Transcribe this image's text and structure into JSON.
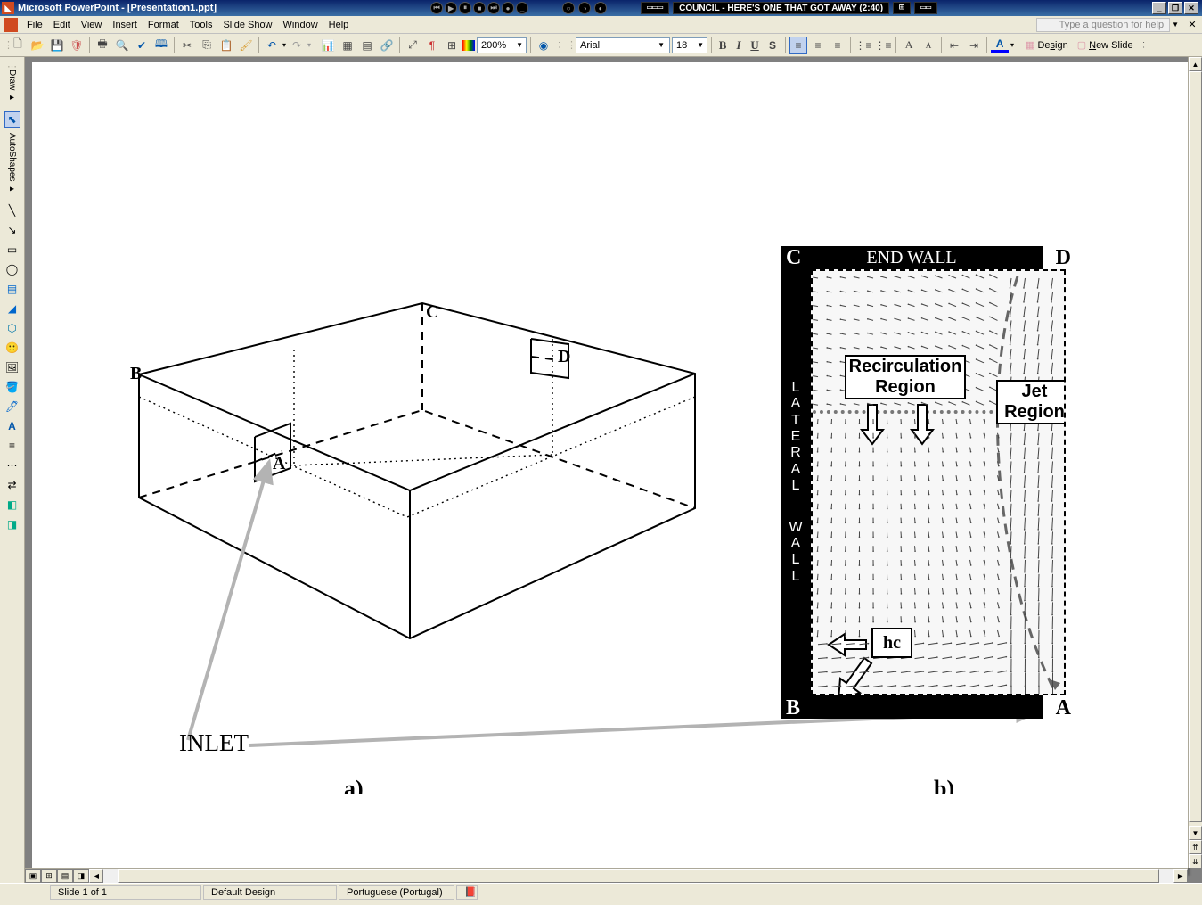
{
  "titlebar": {
    "app": "Microsoft PowerPoint",
    "doc": "[Presentation1.ppt]",
    "tasktext": "COUNCIL - HERE'S ONE THAT GOT AWAY (2:40)"
  },
  "menu": {
    "file": "File",
    "edit": "Edit",
    "view": "View",
    "insert": "Insert",
    "format": "Format",
    "tools": "Tools",
    "slideshow": "Slide Show",
    "window": "Window",
    "help": "Help",
    "askhelp": "Type a question for help"
  },
  "toolbar": {
    "zoom": "200%",
    "font": "Arial",
    "size": "18",
    "design": "Design",
    "newslide": "New Slide"
  },
  "leftdock": {
    "draw": "Draw",
    "autoshapes": "AutoShapes"
  },
  "slide": {
    "inlet": "INLET",
    "a_label": "a)",
    "b_label": "b)",
    "pts": {
      "A": "A",
      "B": "B",
      "C": "C",
      "D": "D"
    },
    "panel": {
      "endwall": "END WALL",
      "lateral": "LATERAL",
      "wall": "WALL",
      "recirc": "Recirculation Region",
      "jet": "Jet Region",
      "hc": "hc"
    }
  },
  "status": {
    "slide": "Slide 1 of 1",
    "design": "Default Design",
    "lang": "Portuguese (Portugal)"
  }
}
